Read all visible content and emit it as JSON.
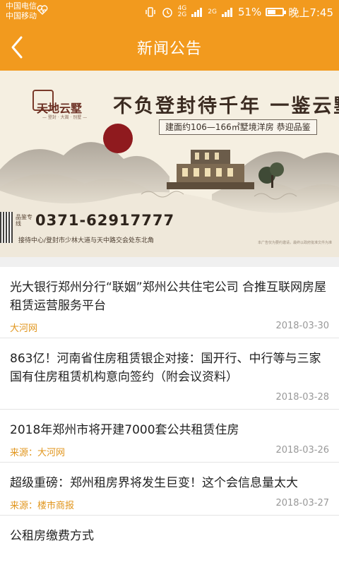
{
  "status_bar": {
    "carrier_1": "中国电信",
    "carrier_2": "中国移动",
    "net_1": "4G",
    "net_2": "2G",
    "net_3": "2G",
    "battery_percent": "51%",
    "time": "晚上7:45"
  },
  "header": {
    "title": "新闻公告"
  },
  "banner": {
    "logo_text": "天地云墅",
    "logo_subtext": "— 登封 · 大嵩 · 别墅 —",
    "slogan": "不负登封待千年  一鉴云墅",
    "area_text": "建面约106—166㎡墅境洋房 恭迎品鉴",
    "phone_label": "品鉴专线",
    "phone": "0371-62917777",
    "address": "接待中心/登封市少林大道与天中路交会处东北角",
    "fineprint": "本广告仅为要约邀请，最终以政府批准文件为准"
  },
  "news": [
    {
      "title": "光大银行郑州分行“联姻”郑州公共住宅公司 合推互联网房屋租赁运营服务平台",
      "source": "大河网",
      "date": "2018-03-30"
    },
    {
      "title": "863亿！河南省住房租赁银企对接：国开行、中行等与三家国有住房租赁机构意向签约（附会议资料）",
      "source": "",
      "date": "2018-03-28"
    },
    {
      "title": "2018年郑州市将开建7000套公共租赁住房",
      "source": "来源：大河网",
      "date": "2018-03-26"
    },
    {
      "title": "超级重磅：郑州租房界将发生巨变！这个会信息量太大",
      "source": "来源：楼市商报",
      "date": "2018-03-27"
    },
    {
      "title": "公租房缴费方式",
      "source": "",
      "date": ""
    }
  ],
  "colors": {
    "accent": "#f29a1e",
    "source_text": "#e1961e"
  }
}
